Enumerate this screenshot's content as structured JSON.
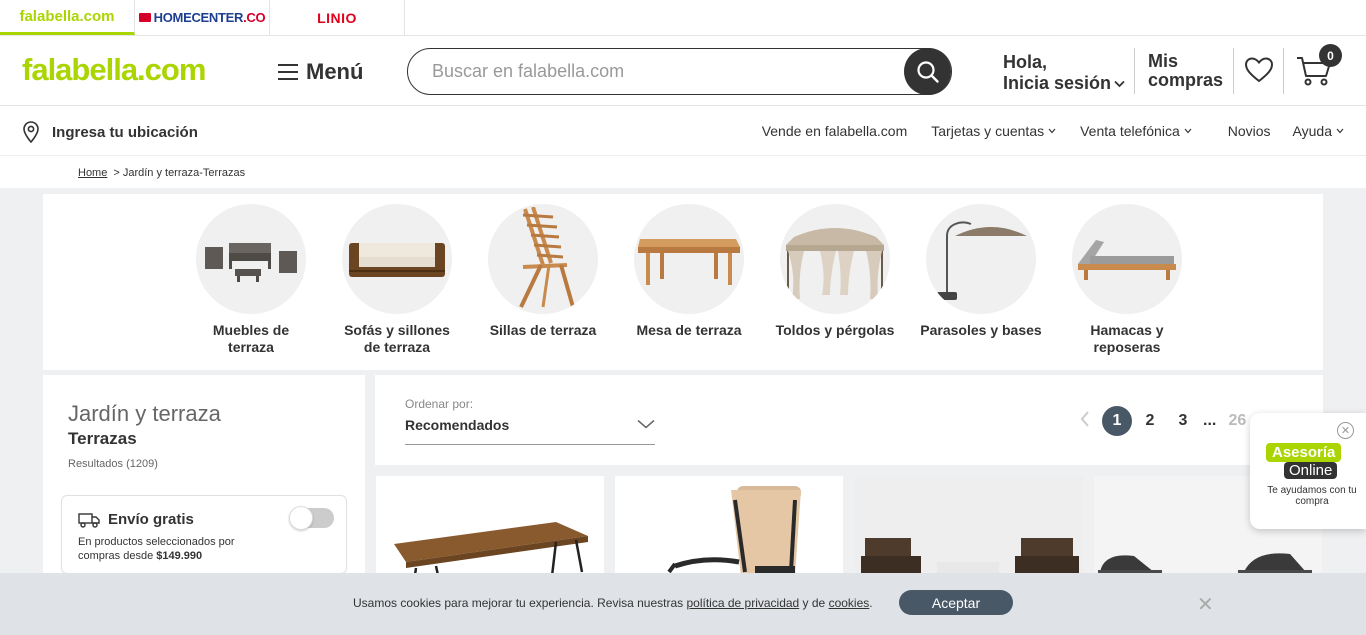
{
  "brands": [
    {
      "name": "falabella.com"
    },
    {
      "name_a": "HOMECENTER",
      "name_b": ".CO"
    },
    {
      "name": "LINIO"
    }
  ],
  "header": {
    "logo": "falabella.com",
    "menu_label": "Menú",
    "search_placeholder": "Buscar en falabella.com",
    "greeting_line1": "Hola,",
    "greeting_line2": "Inicia sesión",
    "orders_line1": "Mis",
    "orders_line2": "compras",
    "cart_count": "0"
  },
  "locbar": {
    "location": "Ingresa tu ubicación",
    "nav": [
      {
        "label": "Vende en falabella.com"
      },
      {
        "label": "Tarjetas y cuentas"
      },
      {
        "label": "Venta telefónica"
      },
      {
        "label": "Novios"
      },
      {
        "label": "Ayuda"
      }
    ]
  },
  "breadcrumb": {
    "home": "Home",
    "current": "> Jardín y terraza-Terrazas"
  },
  "categories": [
    {
      "l1": "Muebles de",
      "l2": "terraza"
    },
    {
      "l1": "Sofás y sillones",
      "l2": "de terraza"
    },
    {
      "l1": "Sillas de terraza",
      "l2": ""
    },
    {
      "l1": "Mesa de terraza",
      "l2": ""
    },
    {
      "l1": "Toldos y pérgolas",
      "l2": ""
    },
    {
      "l1": "Parasoles y bases",
      "l2": ""
    },
    {
      "l1": "Hamacas y",
      "l2": "reposeras"
    }
  ],
  "sidebar": {
    "title": "Jardín y terraza",
    "subtitle": "Terrazas",
    "results": "Resultados (1209)",
    "envio_title": "Envío gratis",
    "envio_desc_a": "En productos seleccionados por compras desde ",
    "envio_desc_b": "$149.990"
  },
  "sort": {
    "label": "Ordenar por:",
    "value": "Recomendados"
  },
  "pager": {
    "pages": [
      "1",
      "2",
      "3"
    ],
    "ellipsis": "...",
    "last": "26"
  },
  "chat": {
    "close": "✕",
    "line1": "Asesoría",
    "line2": "Online",
    "text": "Te ayudamos con tu compra"
  },
  "cookie": {
    "msg_a": "Usamos cookies para mejorar tu experiencia. Revisa nuestras ",
    "link1": "política de privacidad",
    "msg_b": " y de ",
    "link2": "cookies",
    "msg_c": ".",
    "accept": "Aceptar",
    "close": "✕"
  },
  "colors": {
    "brand_green": "#aad500",
    "dark": "#333333",
    "accent_slate": "#495867"
  },
  "icons": [
    "hamburger-icon",
    "search-icon",
    "chevron-down-icon",
    "heart-icon",
    "cart-icon",
    "location-pin-icon",
    "truck-icon",
    "chevron-left-icon",
    "close-icon"
  ]
}
